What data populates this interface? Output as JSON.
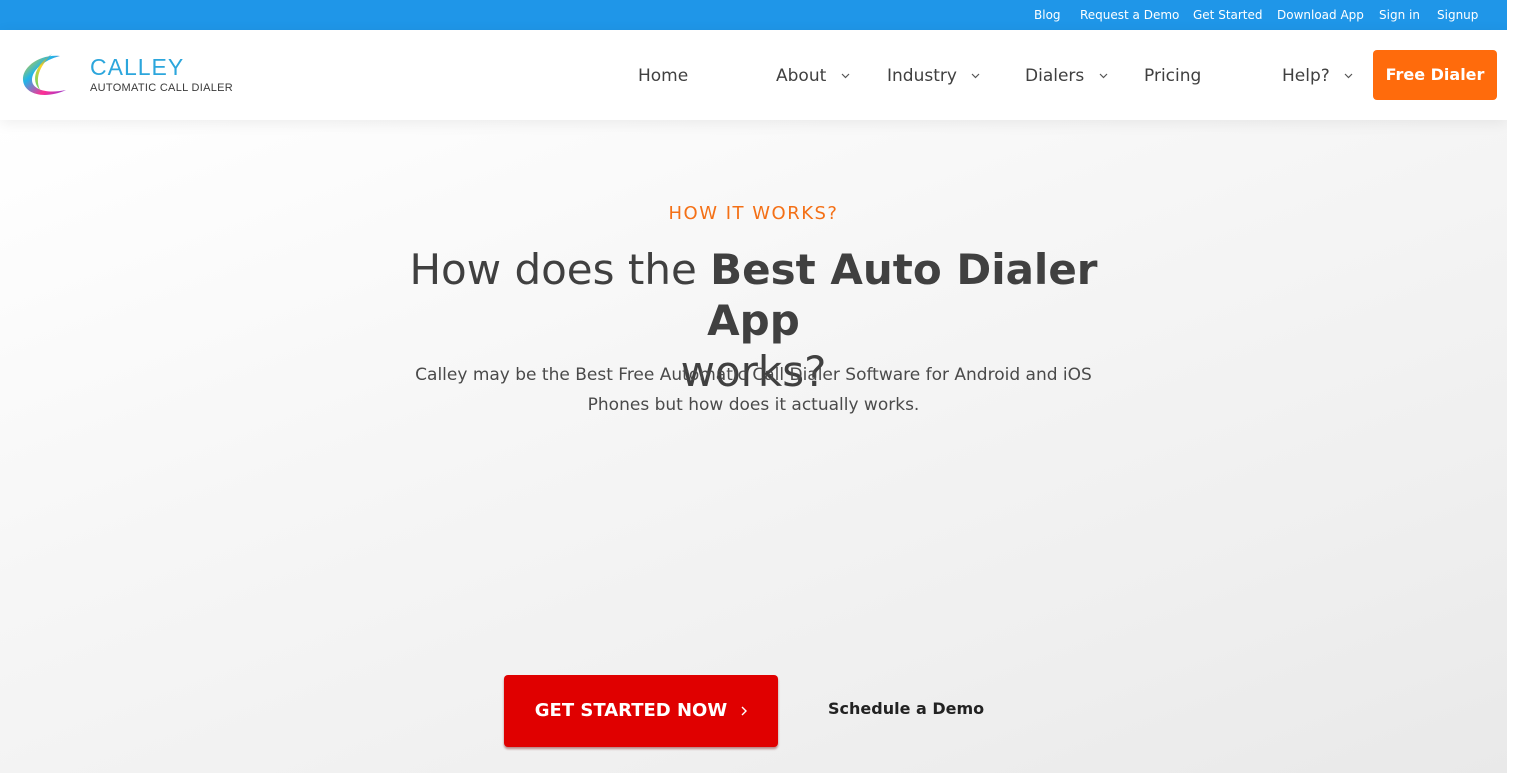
{
  "topbar": {
    "links": [
      "Blog",
      "Request a Demo",
      "Get Started",
      "Download App",
      "Sign in",
      "Signup"
    ]
  },
  "logo": {
    "name": "CALLEY",
    "tagline": "AUTOMATIC CALL DIALER"
  },
  "nav": {
    "home": "Home",
    "about": "About",
    "industry": "Industry",
    "dialers": "Dialers",
    "pricing": "Pricing",
    "help": "Help?",
    "cta": "Free Dialer"
  },
  "hero": {
    "eyebrow": "HOW IT WORKS?",
    "headline_pre": "How does the",
    "headline_bold": "Best Auto Dialer App",
    "headline_post": "works?",
    "subtext": "Calley may be the Best Free Automatic Call Dialer Software for Android and iOS Phones but how does it actually works.",
    "primary_cta": "GET STARTED NOW",
    "secondary_cta": "Schedule a Demo"
  },
  "colors": {
    "topbar": "#1f96e8",
    "accent_orange": "#ff6b0c",
    "cta_red": "#e00000"
  }
}
